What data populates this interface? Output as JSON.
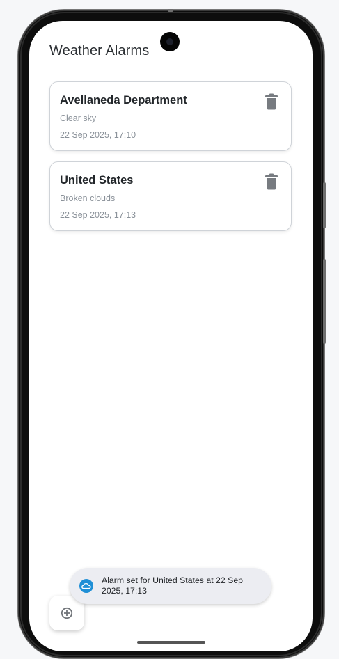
{
  "app": {
    "title": "Weather Alarms"
  },
  "alarms": [
    {
      "location": "Avellaneda Department",
      "condition": "Clear sky",
      "datetime": "22 Sep 2025, 17:10",
      "delete_icon": "trash-icon"
    },
    {
      "location": "United States",
      "condition": "Broken clouds",
      "datetime": "22 Sep 2025, 17:13",
      "delete_icon": "trash-icon"
    }
  ],
  "snackbar": {
    "icon": "cloud-icon",
    "message": "Alarm set for United States at 22 Sep 2025, 17:13"
  },
  "fab": {
    "icon": "add-circle-icon"
  },
  "colors": {
    "text_primary": "#22262a",
    "text_secondary": "#8a9199",
    "icon_gray": "#777b80",
    "snackbar_bg": "#ecedf2",
    "cloud_blue": "#1f8fd6"
  }
}
